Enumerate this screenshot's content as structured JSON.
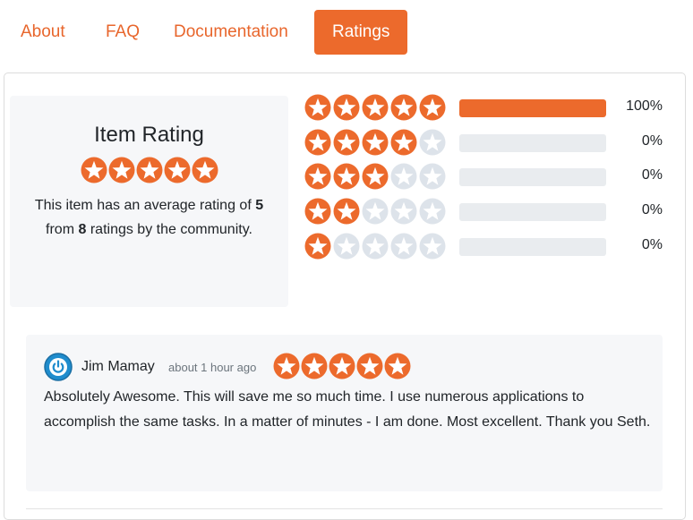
{
  "tabs": [
    {
      "label": "About",
      "active": false
    },
    {
      "label": "FAQ",
      "active": false
    },
    {
      "label": "Documentation",
      "active": false
    },
    {
      "label": "Ratings",
      "active": true
    }
  ],
  "summary": {
    "title": "Item Rating",
    "stars": 5,
    "text_before": "This item has an average rating of ",
    "average": "5",
    "text_mid": " from ",
    "count": "8",
    "text_after": " ratings by the community."
  },
  "breakdown": [
    {
      "stars": 5,
      "percent": "100%",
      "fraction": 1.0
    },
    {
      "stars": 4,
      "percent": "0%",
      "fraction": 0
    },
    {
      "stars": 3,
      "percent": "0%",
      "fraction": 0
    },
    {
      "stars": 2,
      "percent": "0%",
      "fraction": 0
    },
    {
      "stars": 1,
      "percent": "0%",
      "fraction": 0
    }
  ],
  "review": {
    "reviewer": "Jim Mamay",
    "time": "about 1 hour ago",
    "stars": 5,
    "body": "Absolutely Awesome. This will save me so much time. I use numerous applications to accomplish the same tasks. In a matter of minutes - I am done. Most excellent. Thank you Seth.",
    "avatar_icon": "power-icon"
  },
  "colors": {
    "accent": "#ec6a2c",
    "star_empty": "#dde3ea",
    "bar_track": "#e9ecef"
  }
}
